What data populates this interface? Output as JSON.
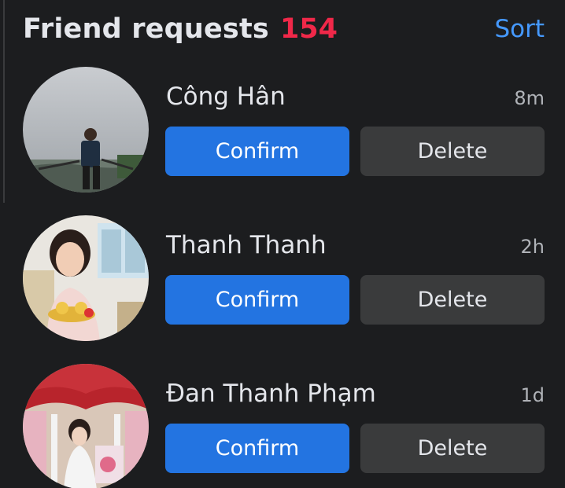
{
  "header": {
    "title": "Friend requests",
    "count": "154",
    "sort_label": "Sort"
  },
  "requests": [
    {
      "name": "Công Hân",
      "time": "8m",
      "confirm_label": "Confirm",
      "delete_label": "Delete"
    },
    {
      "name": "Thanh Thanh",
      "time": "2h",
      "confirm_label": "Confirm",
      "delete_label": "Delete"
    },
    {
      "name": "Đan Thanh Phạm",
      "time": "1d",
      "confirm_label": "Confirm",
      "delete_label": "Delete"
    }
  ],
  "colors": {
    "background": "#1c1d1f",
    "count_red": "#f02849",
    "link_blue": "#4599ff",
    "confirm_blue": "#2374e1",
    "delete_gray": "#3a3b3c"
  }
}
